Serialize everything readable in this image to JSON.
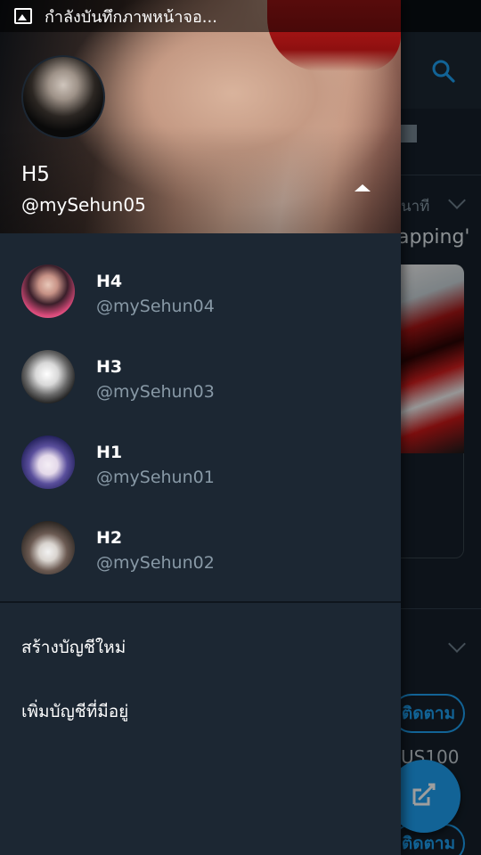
{
  "status_bar": {
    "text": "กำลังบันทึกภาพหน้าจอ...",
    "icon": "image-icon"
  },
  "background": {
    "time_fragment": "นาที",
    "tweet_fragment": "apping'",
    "follow_label": "ติดตาม",
    "price_fragment": "US100",
    "accent_color": "#1da1f2",
    "icons": [
      "search-icon",
      "mail-icon",
      "chevron-down-icon",
      "compose-tweet-icon"
    ]
  },
  "drawer": {
    "current_account": {
      "name": "H5",
      "handle": "@mySehun05"
    },
    "accounts": [
      {
        "name": "H4",
        "handle": "@mySehun04"
      },
      {
        "name": "H3",
        "handle": "@mySehun03"
      },
      {
        "name": "H1",
        "handle": "@mySehun01"
      },
      {
        "name": "H2",
        "handle": "@mySehun02"
      }
    ],
    "menu": {
      "create_account": "สร้างบัญชีใหม่",
      "add_existing": "เพิ่มบัญชีที่มีอยู่"
    },
    "colors": {
      "background": "#1c2733",
      "handle_text": "#8899a6"
    }
  }
}
